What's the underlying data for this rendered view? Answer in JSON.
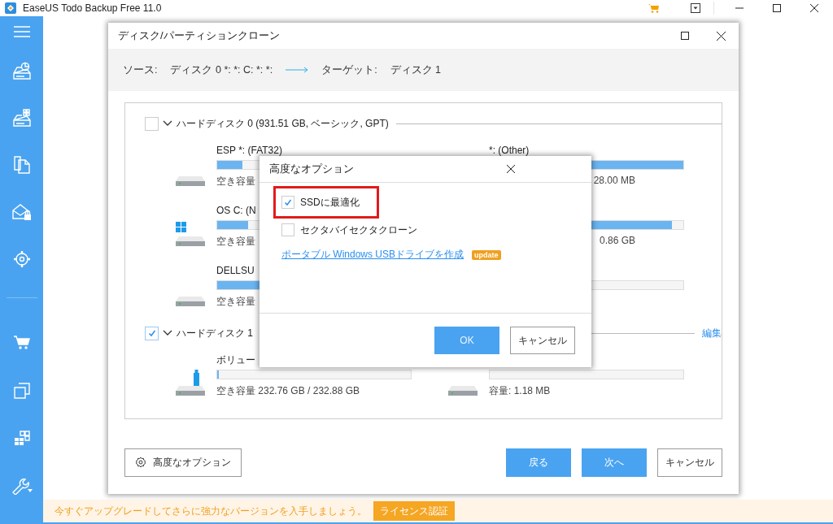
{
  "app": {
    "title": "EaseUS Todo Backup Free 11.0"
  },
  "clone_dialog": {
    "title": "ディスク/パーティションクローン",
    "source_label": "ソース:",
    "source_value": "ディスク 0 *: *: C: *: *:",
    "target_label": "ターゲット:",
    "target_value": "ディスク 1",
    "disks": [
      {
        "label": "ハードディスク 0 (931.51 GB, ベーシック, GPT)",
        "checked": false,
        "partitions": [
          {
            "kind": "disk",
            "name": "ESP *: (FAT32)",
            "level": 0.13,
            "caption": "空き容量"
          },
          {
            "kind": "hidden",
            "name": "*: (Other)",
            "level": 1.0,
            "caption": "28.00 MB",
            "clipped": true
          },
          {
            "kind": "windows",
            "name": "OS C: (N",
            "level": 0.16,
            "caption": "空き容量"
          },
          {
            "kind": "hidden",
            "level": 0.94,
            "caption": "0.86 GB",
            "clipped": true
          },
          {
            "kind": "disk",
            "name": "DELLSU",
            "level": 0.5,
            "caption": "空き容量"
          },
          {
            "kind": "hidden",
            "level": 0
          }
        ]
      },
      {
        "label": "ハードディスク 1",
        "checked": true,
        "edit_link": "編集",
        "partitions": [
          {
            "kind": "usb",
            "name": "ボリュー",
            "level": 0.01,
            "caption": "空き容量 232.76 GB / 232.88 GB"
          },
          {
            "kind": "disk",
            "level": 0,
            "caption": "容量: 1.18 MB"
          }
        ]
      }
    ],
    "advanced_button": "高度なオプション",
    "back_button": "戻る",
    "next_button": "次へ",
    "cancel_button": "キャンセル"
  },
  "options_dialog": {
    "title": "高度なオプション",
    "options": [
      {
        "label": "SSDに最適化",
        "checked": true,
        "highlighted": true
      },
      {
        "label": "セクタバイセクタクローン",
        "checked": false,
        "highlighted": false
      }
    ],
    "link": "ポータブル Windows USBドライブを作成",
    "badge": "update",
    "ok_button": "OK",
    "cancel_button": "キャンセル"
  },
  "bottom_bar": {
    "message": "今すぐアップグレードしてさらに強力なバージョンを入手しましょう。",
    "button": "ライセンス認証"
  }
}
